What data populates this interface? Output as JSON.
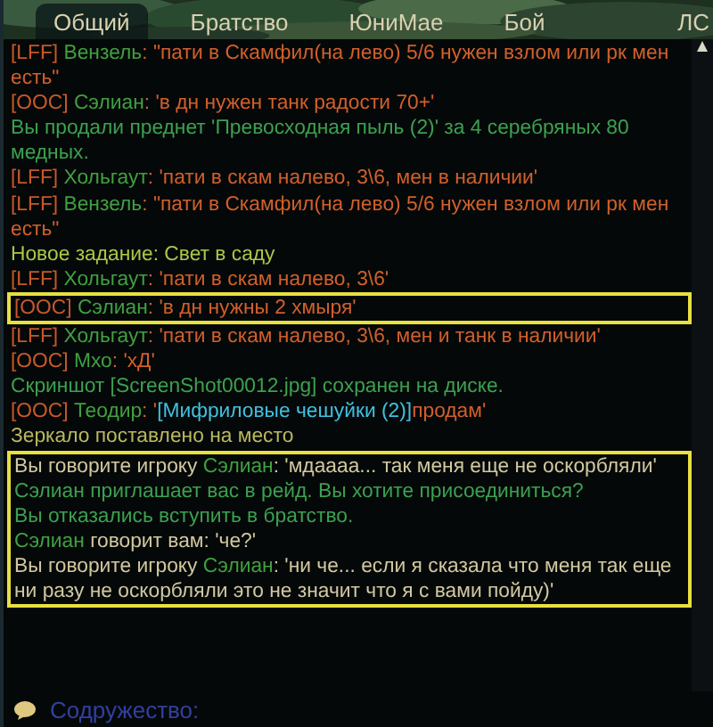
{
  "tabs": [
    {
      "label": "Общий",
      "selected": true
    },
    {
      "label": "Братство",
      "selected": false
    },
    {
      "label": "ЮниМае",
      "selected": false
    },
    {
      "label": "Бой",
      "selected": false
    },
    {
      "label": "ЛС",
      "selected": false
    }
  ],
  "messages": [
    {
      "boxed": false,
      "parts": [
        {
          "kind": "channel",
          "text": "[LFF] "
        },
        {
          "kind": "name",
          "text": "Вензель"
        },
        {
          "kind": "speech",
          "text": ": \"пати в Скамфил(на лево) 5/6 нужен взлом или рк мен есть\""
        }
      ]
    },
    {
      "boxed": false,
      "parts": [
        {
          "kind": "channel",
          "text": "[OOC] "
        },
        {
          "kind": "name",
          "text": "Сэлиан"
        },
        {
          "kind": "speech",
          "text": ": 'в дн нужен танк радости 70+'"
        }
      ]
    },
    {
      "boxed": false,
      "parts": [
        {
          "kind": "system",
          "text": "Вы продали преднет 'Превосходная пыль (2)' за 4 серебряных 80 медных."
        }
      ]
    },
    {
      "boxed": false,
      "parts": [
        {
          "kind": "channel",
          "text": "[LFF] "
        },
        {
          "kind": "name",
          "text": "Хольгаут"
        },
        {
          "kind": "speech",
          "text": ": 'пати в скам налево, 3\\6, мен в наличии'"
        }
      ]
    },
    {
      "boxed": false,
      "parts": [
        {
          "kind": "channel",
          "text": "[LFF] "
        },
        {
          "kind": "name",
          "text": "Вензель"
        },
        {
          "kind": "speech",
          "text": ": \"пати в Скамфил(на лево) 5/6 нужен взлом или рк мен есть\""
        }
      ]
    },
    {
      "boxed": false,
      "parts": [
        {
          "kind": "quest",
          "text": "Новое задание: Свет в саду"
        }
      ]
    },
    {
      "boxed": false,
      "parts": [
        {
          "kind": "channel",
          "text": "[LFF] "
        },
        {
          "kind": "name",
          "text": "Хольгаут"
        },
        {
          "kind": "speech",
          "text": ": 'пати в скам налево, 3\\6'"
        }
      ]
    },
    {
      "boxed": true,
      "parts": [
        {
          "kind": "channel",
          "text": "[OOC] "
        },
        {
          "kind": "name",
          "text": "Сэлиан"
        },
        {
          "kind": "speech",
          "text": ": 'в дн нужны 2 хмыря'"
        }
      ]
    },
    {
      "boxed": false,
      "parts": [
        {
          "kind": "channel",
          "text": "[LFF] "
        },
        {
          "kind": "name",
          "text": "Хольгаут"
        },
        {
          "kind": "speech",
          "text": ": 'пати в скам налево, 3\\6, мен и танк в наличии'"
        }
      ]
    },
    {
      "boxed": false,
      "parts": [
        {
          "kind": "channel",
          "text": "[OOC] "
        },
        {
          "kind": "name",
          "text": "Мхо"
        },
        {
          "kind": "speech",
          "text": ": 'хД'"
        }
      ]
    },
    {
      "boxed": false,
      "parts": [
        {
          "kind": "system",
          "text": "Скриншот [ScreenShot00012.jpg] сохранен на диске."
        }
      ]
    },
    {
      "boxed": false,
      "parts": [
        {
          "kind": "channel",
          "text": "[OOC] "
        },
        {
          "kind": "name",
          "text": "Теодир"
        },
        {
          "kind": "speech",
          "text": ": '"
        },
        {
          "kind": "link",
          "text": "[Мифриловые чешуйки (2)]"
        },
        {
          "kind": "speech",
          "text": "продам'"
        }
      ]
    },
    {
      "boxed": false,
      "parts": [
        {
          "kind": "notice",
          "text": "Зеркало поставлено на место"
        }
      ]
    },
    {
      "boxed": true,
      "parts": [
        {
          "kind": "whisper",
          "text": "Вы говорите игроку "
        },
        {
          "kind": "name",
          "text": "Сэлиан"
        },
        {
          "kind": "whisper",
          "text": ": 'мдаааа... так меня еще не оскорбляли'"
        }
      ]
    },
    {
      "boxed": true,
      "parts": [
        {
          "kind": "system",
          "text": "Сэлиан приглашает вас в рейд. Вы хотите присоединиться?"
        }
      ]
    },
    {
      "boxed": true,
      "parts": [
        {
          "kind": "system",
          "text": "Вы отказались вступить в братство."
        }
      ]
    },
    {
      "boxed": true,
      "parts": [
        {
          "kind": "name",
          "text": "Сэлиан"
        },
        {
          "kind": "whisper",
          "text": " говорит вам: 'че?'"
        }
      ]
    },
    {
      "boxed": true,
      "parts": [
        {
          "kind": "whisper",
          "text": "Вы говорите игроку "
        },
        {
          "kind": "name",
          "text": "Сэлиан"
        },
        {
          "kind": "whisper",
          "text": ": 'ни че... если я сказала что меня так еще ни разу не оскорбляли это не значит что я с вами пойду)'"
        }
      ]
    }
  ],
  "input": {
    "placeholder": "Содружество:"
  }
}
